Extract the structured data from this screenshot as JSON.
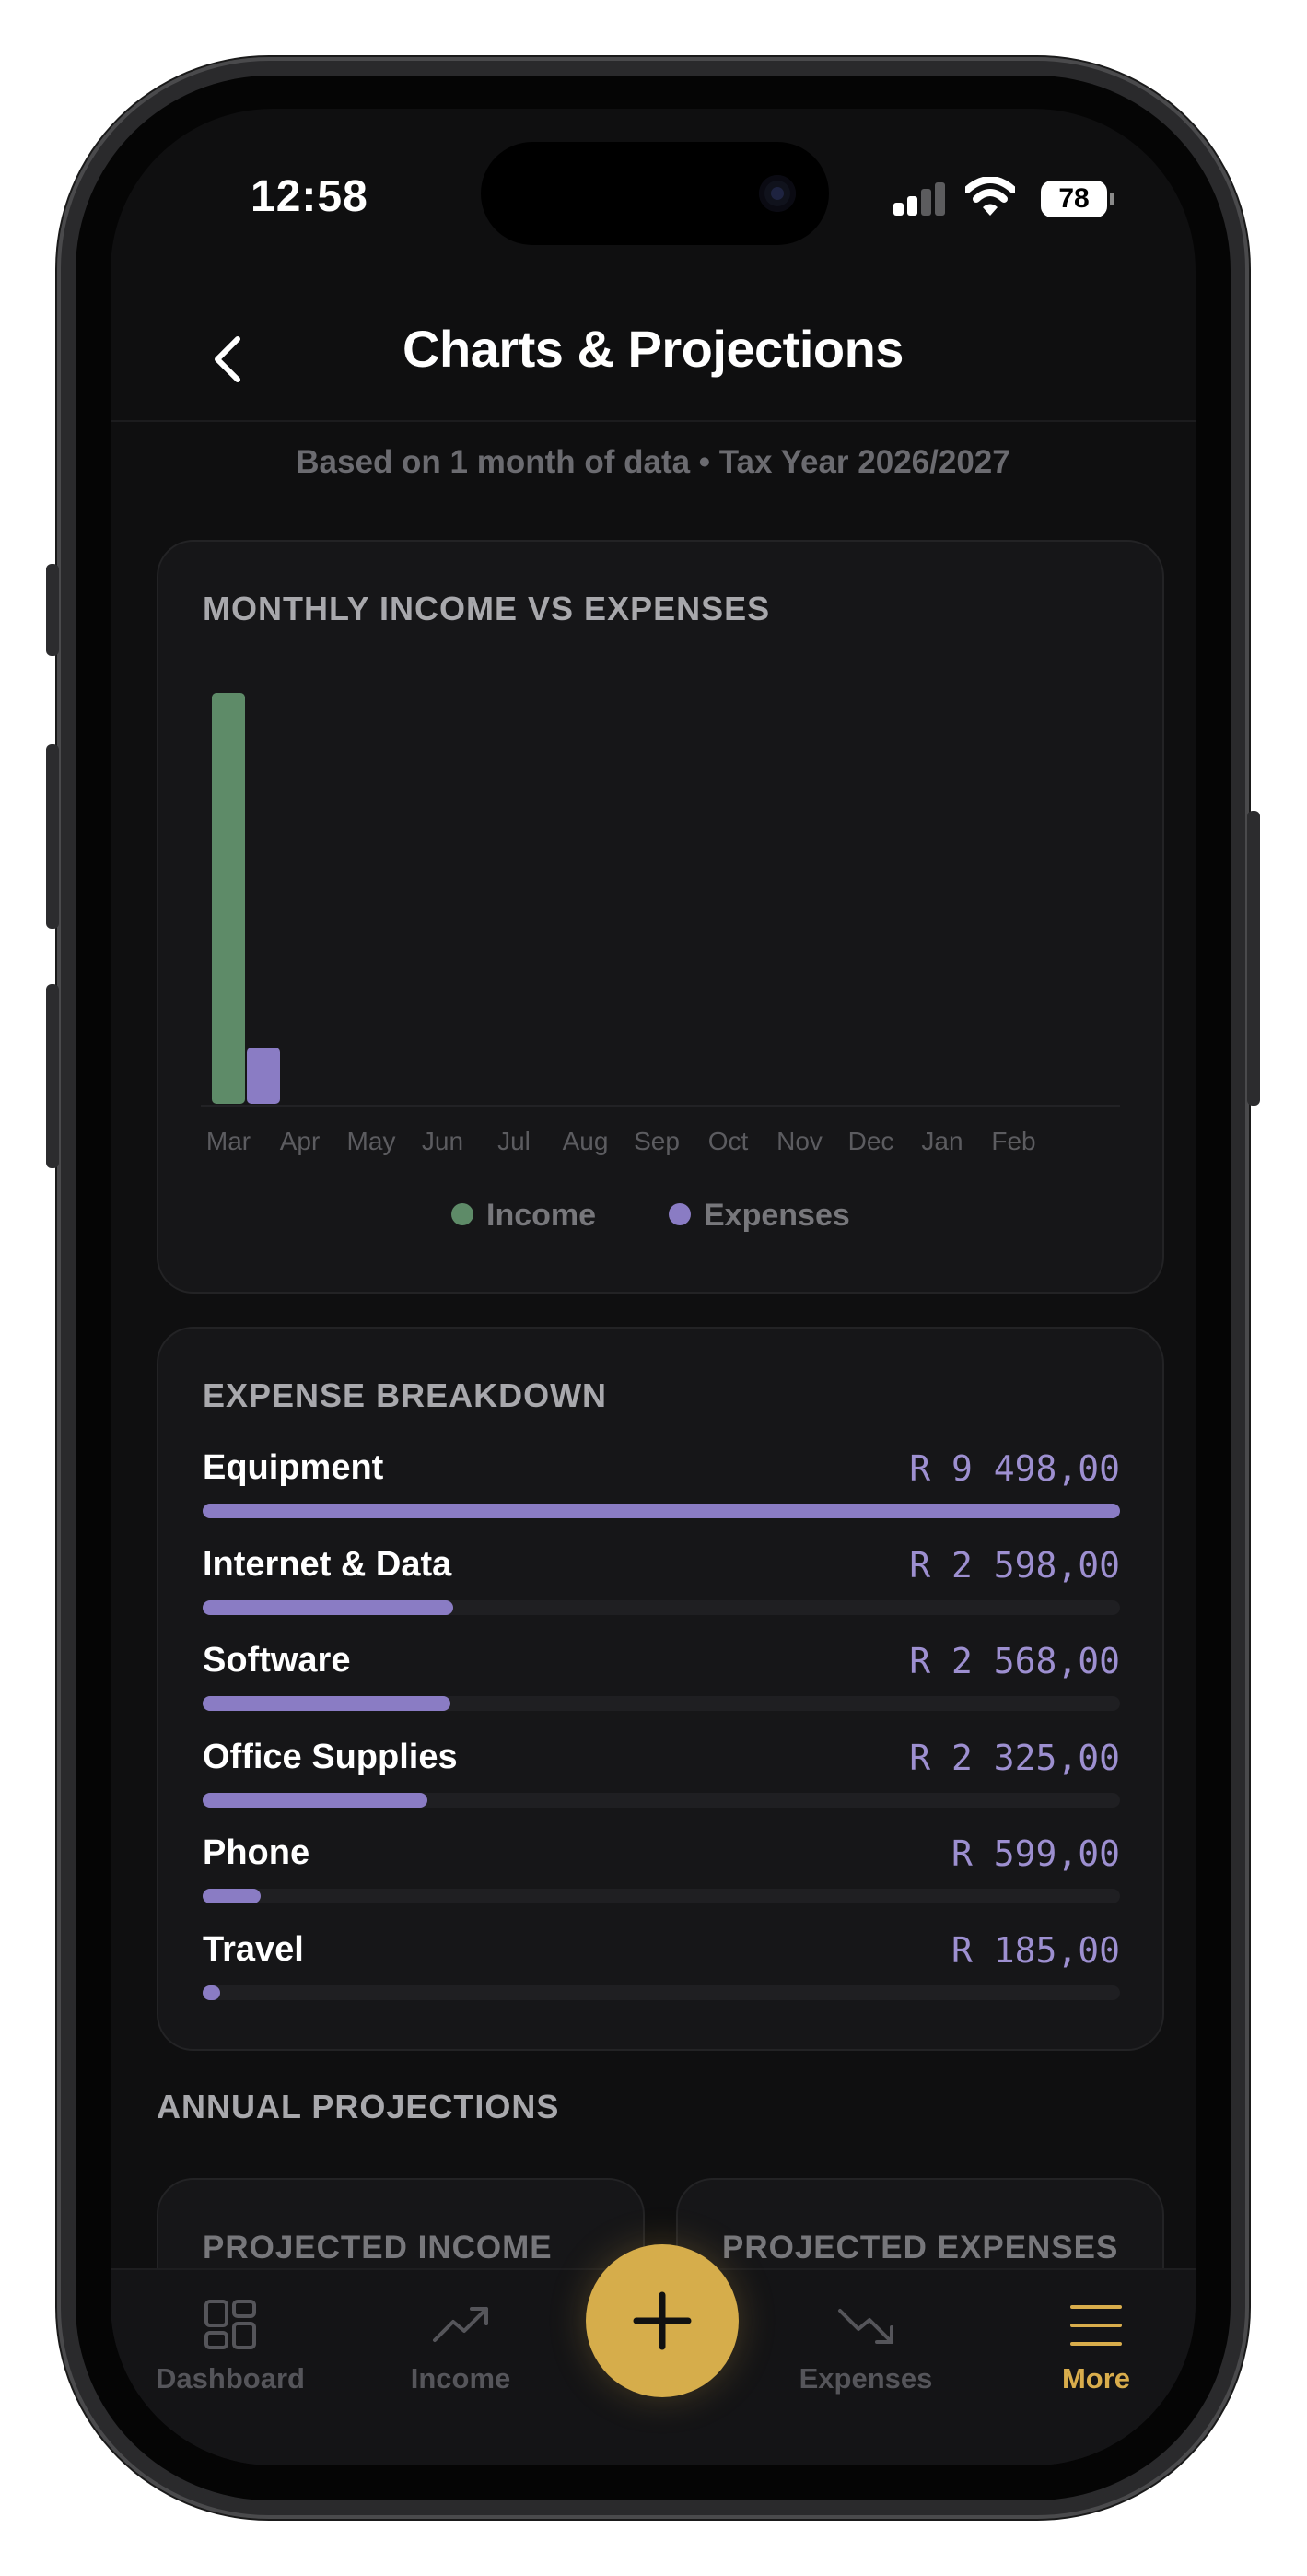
{
  "status_bar": {
    "time": "12:58",
    "battery": "78"
  },
  "header": {
    "title": "Charts & Projections"
  },
  "subtitle": "Based on 1 month of data • Tax Year 2026/2027",
  "chart_card": {
    "title": "MONTHLY INCOME VS EXPENSES",
    "chart_data": {
      "type": "bar",
      "categories": [
        "Mar",
        "Apr",
        "May",
        "Jun",
        "Jul",
        "Aug",
        "Sep",
        "Oct",
        "Nov",
        "Dec",
        "Jan",
        "Feb"
      ],
      "series": [
        {
          "name": "Income",
          "color": "#5e8b68",
          "values": [
            130000,
            0,
            0,
            0,
            0,
            0,
            0,
            0,
            0,
            0,
            0,
            0
          ]
        },
        {
          "name": "Expenses",
          "color": "#8a7cc4",
          "values": [
            17773,
            0,
            0,
            0,
            0,
            0,
            0,
            0,
            0,
            0,
            0,
            0
          ]
        }
      ],
      "title": "MONTHLY INCOME VS EXPENSES",
      "xlabel": "",
      "ylabel": "",
      "ylim": [
        0,
        130000
      ],
      "grid": false,
      "legend_position": "bottom"
    }
  },
  "breakdown": {
    "title": "EXPENSE BREAKDOWN",
    "items": [
      {
        "name": "Equipment",
        "amount": "R 9 498,00",
        "value": 9498
      },
      {
        "name": "Internet & Data",
        "amount": "R 2 598,00",
        "value": 2598
      },
      {
        "name": "Software",
        "amount": "R 2 568,00",
        "value": 2568
      },
      {
        "name": "Office Supplies",
        "amount": "R 2 325,00",
        "value": 2325
      },
      {
        "name": "Phone",
        "amount": "R 599,00",
        "value": 599
      },
      {
        "name": "Travel",
        "amount": "R 185,00",
        "value": 185
      }
    ]
  },
  "projections": {
    "title": "ANNUAL PROJECTIONS",
    "income_label": "PROJECTED INCOME",
    "expenses_label": "PROJECTED EXPENSES"
  },
  "tabbar": {
    "dashboard": "Dashboard",
    "income": "Income",
    "expenses": "Expenses",
    "more": "More",
    "active": "more"
  },
  "colors": {
    "accent": "#d6ad4b",
    "income": "#5e8b68",
    "expense": "#8a7cc4",
    "background": "#0f0f10"
  }
}
